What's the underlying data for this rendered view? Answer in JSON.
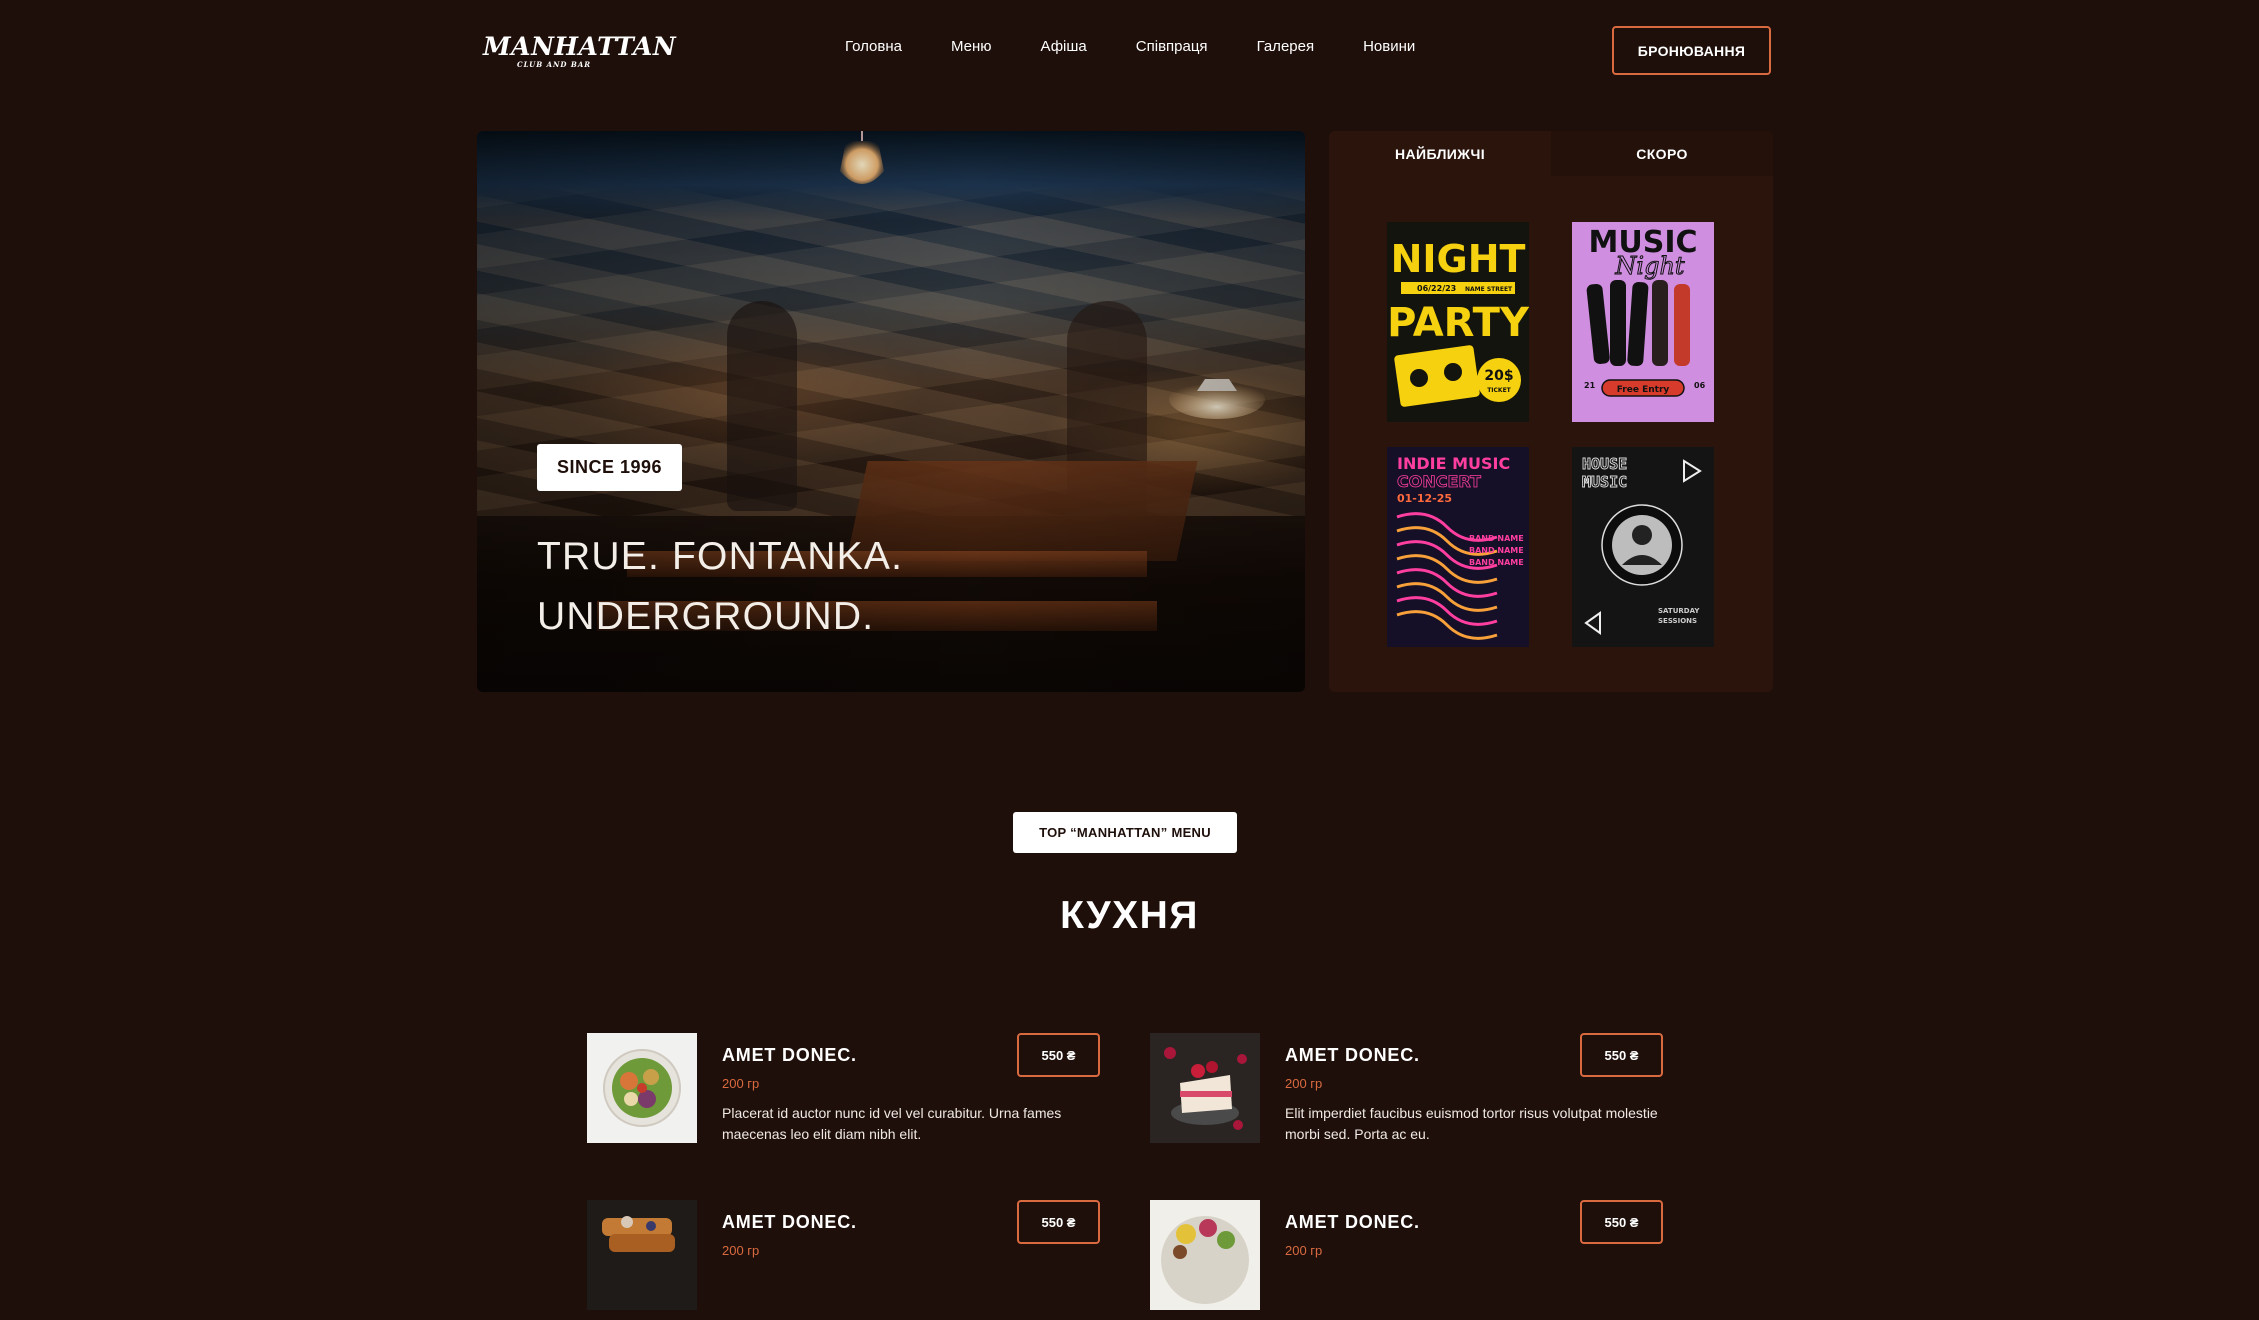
{
  "header": {
    "logo_name": "MANHATTAN",
    "logo_sub": "CLUB AND BAR",
    "nav": [
      "Головна",
      "Меню",
      "Афіша",
      "Співпраця",
      "Галерея",
      "Новини"
    ],
    "book_label": "БРОНЮВАННЯ"
  },
  "hero": {
    "badge": "SINCE 1996",
    "title_line1": "TRUE. FONTANKA.",
    "title_line2": "UNDERGROUND."
  },
  "events": {
    "tabs": [
      "НАЙБЛИЖЧІ",
      "СКОРО"
    ],
    "posters": [
      {
        "line1": "NIGHT",
        "line2": "PARTY",
        "date": "06/22/23",
        "street": "NAME STREET",
        "price": "20$",
        "ticket": "TICKET"
      },
      {
        "line1": "MUSIC",
        "line2": "Night",
        "entry": "Free Entry",
        "day_left": "21",
        "day_right": "06"
      },
      {
        "line1": "INDIE MUSIC",
        "line2": "CONCERT",
        "date": "01-12-25",
        "bands": [
          "BAND NAME",
          "BAND NAME",
          "BAND NAME"
        ]
      },
      {
        "line1": "HOUSE",
        "line2": "MUSIC",
        "tag": "SATURDAY",
        "tag2": "SESSIONS"
      }
    ]
  },
  "menu": {
    "badge": "TOP “MANHATTAN” MENU",
    "title": "КУХНЯ",
    "items": [
      {
        "name": "AMET DONEC.",
        "weight": "200 гр",
        "price": "550 ₴",
        "desc": "Placerat id auctor nunc id vel vel curabitur. Urna fames maecenas leo elit diam nibh elit."
      },
      {
        "name": "AMET DONEC.",
        "weight": "200 гр",
        "price": "550 ₴",
        "desc": "Elit imperdiet faucibus euismod tortor risus volutpat molestie morbi sed. Porta ac eu."
      },
      {
        "name": "AMET DONEC.",
        "weight": "200 гр",
        "price": "550 ₴",
        "desc": ""
      },
      {
        "name": "AMET DONEC.",
        "weight": "200 гр",
        "price": "550 ₴",
        "desc": ""
      }
    ]
  },
  "colors": {
    "background": "#1e0f0a",
    "accent": "#d96a40",
    "panel": "#2b140c"
  }
}
